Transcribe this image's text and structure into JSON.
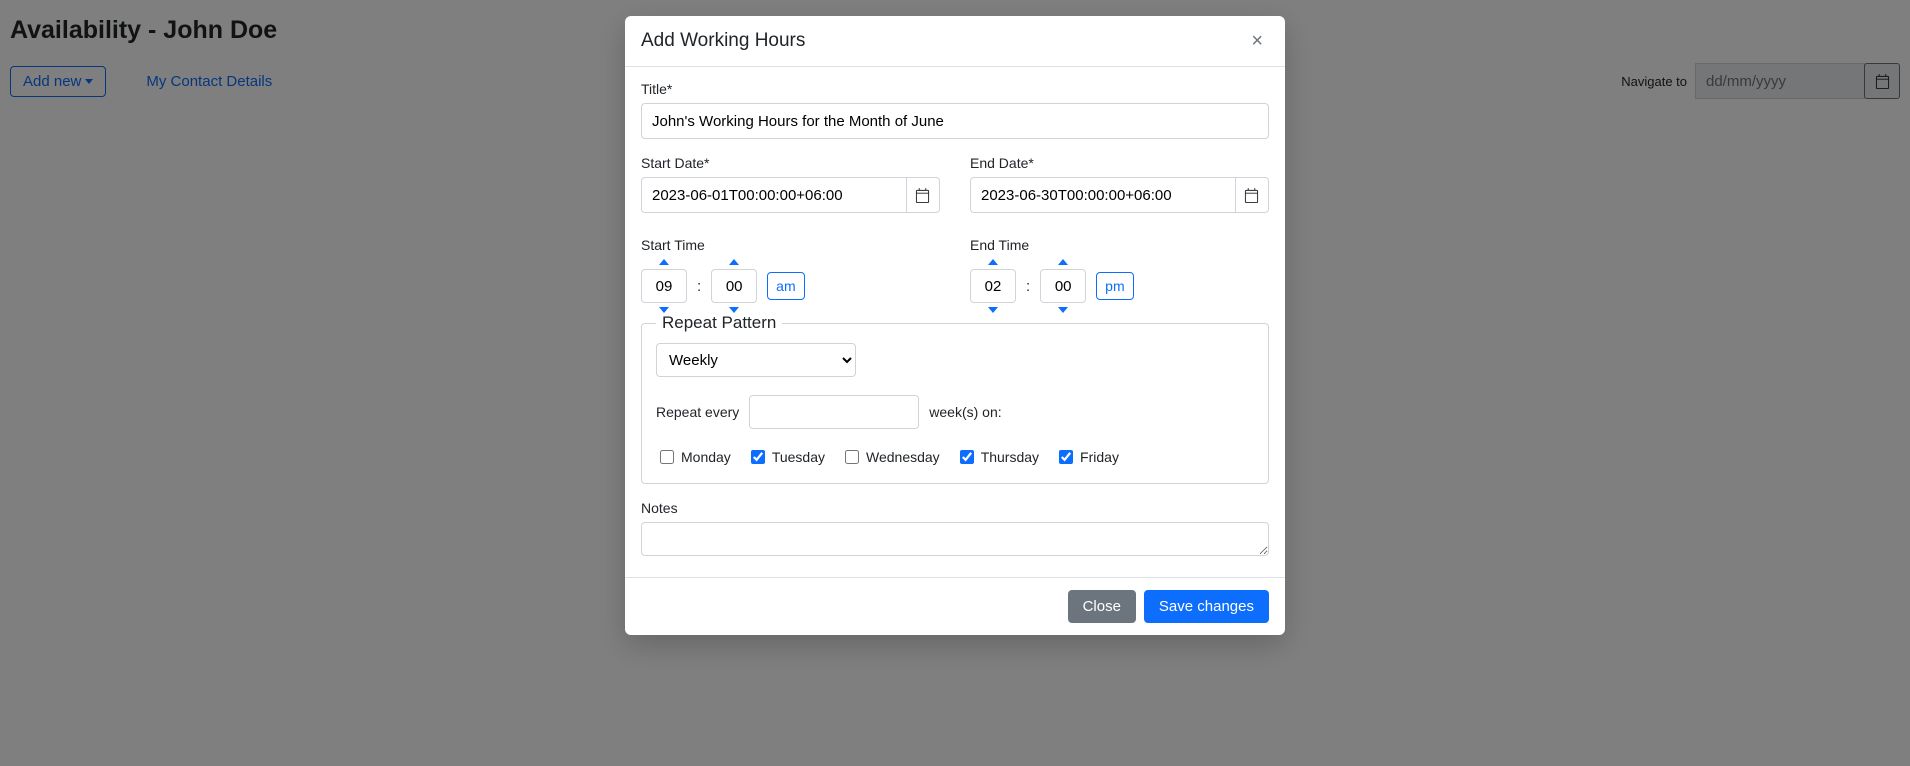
{
  "page": {
    "title": "Availability - John Doe",
    "add_new_label": "Add new",
    "contact_link": "My Contact Details",
    "navigate_label": "Navigate to",
    "navigate_placeholder": "dd/mm/yyyy"
  },
  "modal": {
    "title": "Add Working Hours",
    "close_glyph": "×",
    "labels": {
      "title": "Title*",
      "start_date": "Start Date*",
      "end_date": "End Date*",
      "start_time": "Start Time",
      "end_time": "End Time",
      "repeat_legend": "Repeat Pattern",
      "repeat_every_prefix": "Repeat every",
      "repeat_every_suffix": "week(s) on:",
      "notes": "Notes"
    },
    "values": {
      "title": "John's Working Hours for the Month of June",
      "start_date": "2023-06-01T00:00:00+06:00",
      "end_date": "2023-06-30T00:00:00+06:00",
      "start_hour": "09",
      "start_minute": "00",
      "start_ampm": "am",
      "end_hour": "02",
      "end_minute": "00",
      "end_ampm": "pm",
      "repeat_select": "Weekly",
      "repeat_count": "",
      "notes": ""
    },
    "days": {
      "monday": "Monday",
      "tuesday": "Tuesday",
      "wednesday": "Wednesday",
      "thursday": "Thursday",
      "friday": "Friday",
      "monday_checked": false,
      "tuesday_checked": true,
      "wednesday_checked": false,
      "thursday_checked": true,
      "friday_checked": true
    },
    "footer": {
      "close": "Close",
      "save": "Save changes"
    }
  }
}
